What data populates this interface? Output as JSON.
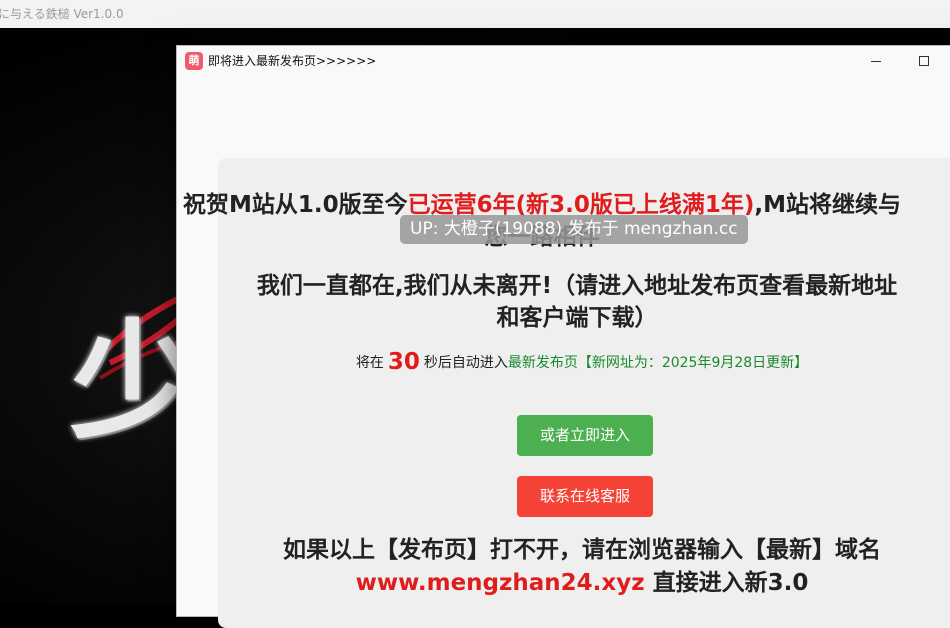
{
  "background_window": {
    "title": "に与える鉄槌 Ver1.0.0",
    "logo_text": "少"
  },
  "dialog": {
    "app_icon_text": "萌",
    "title": "即将进入最新发布页>>>>>>",
    "headline_part1": "祝贺M站从1.0版至今",
    "headline_highlight": "已运营6年(新3.0版已上线满1年)",
    "headline_part2": ",M站将继续与您一路相伴",
    "headline2": "我们一直都在,我们从未离开!（请进入地址发布页查看最新地址和客户端下载）",
    "watermark": "UP: 大橙子(19088) 发布于 mengzhan.cc",
    "countdown_prefix": "将在",
    "countdown_seconds": "30",
    "countdown_suffix": "秒后自动进入",
    "countdown_link": "最新发布页【新网址为：2025年9月28日更新】",
    "enter_now_label": "或者立即进入",
    "contact_label": "联系在线客服",
    "notice_line1": "如果以上【发布页】打不开，请在浏览器输入【最新】域名",
    "notice_url": "www.mengzhan24.xyz",
    "notice_line2_suffix": " 直接进入新3.0"
  },
  "colors": {
    "accent_red": "#e01d1d",
    "accent_green": "#1a8a2e",
    "button_green": "#4caf50",
    "button_red": "#f44336"
  }
}
